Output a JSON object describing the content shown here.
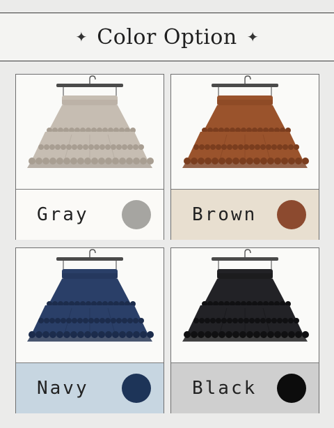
{
  "header": {
    "title": "Color Option",
    "ornament": "✦"
  },
  "options": [
    {
      "name": "Gray",
      "swatch": "#a6a5a1",
      "skirt": "#c6bdb2",
      "skirt_dark": "#a89e92",
      "bar": "#fbfaf7"
    },
    {
      "name": "Brown",
      "swatch": "#8c4a2f",
      "skirt": "#9a532c",
      "skirt_dark": "#7a3d1e",
      "bar": "#e8dfd0"
    },
    {
      "name": "Navy",
      "swatch": "#1d3458",
      "skirt": "#2a3f68",
      "skirt_dark": "#1c2c4c",
      "bar": "#c7d6e1"
    },
    {
      "name": "Black",
      "swatch": "#0c0c0c",
      "skirt": "#222226",
      "skirt_dark": "#101012",
      "bar": "#cfcfcf"
    }
  ]
}
